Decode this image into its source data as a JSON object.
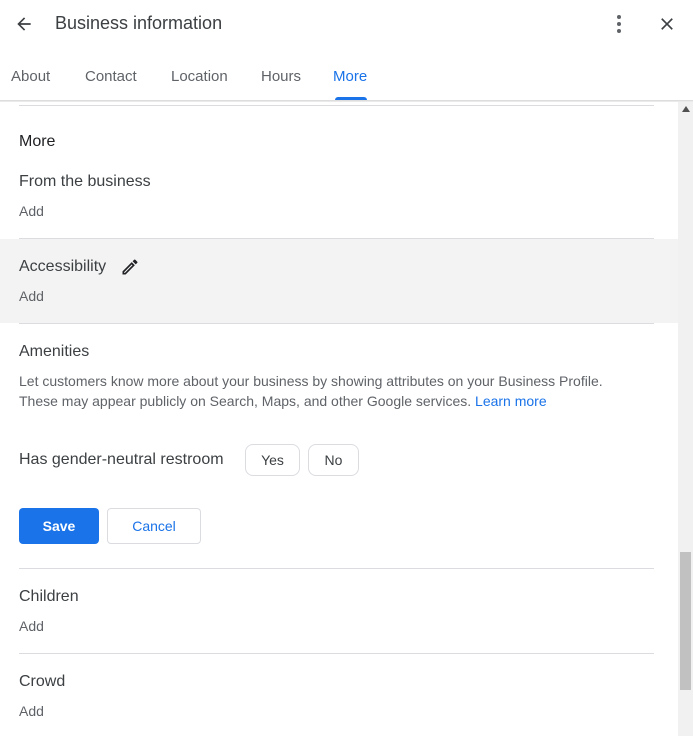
{
  "header": {
    "title": "Business information",
    "back_icon": "arrow-back-icon",
    "more_icon": "more-vert-icon",
    "close_icon": "close-icon"
  },
  "tabs": [
    {
      "label": "About",
      "active": false
    },
    {
      "label": "Contact",
      "active": false
    },
    {
      "label": "Location",
      "active": false
    },
    {
      "label": "Hours",
      "active": false
    },
    {
      "label": "More",
      "active": true
    }
  ],
  "section": {
    "heading": "More",
    "from_business": {
      "title": "From the business",
      "add": "Add"
    },
    "accessibility": {
      "title": "Accessibility",
      "add": "Add",
      "edit_icon": "pencil-icon"
    },
    "amenities": {
      "title": "Amenities",
      "description": "Let customers know more about your business by showing attributes on your Business Profile. These may appear publicly on Search, Maps, and other Google services.",
      "learn_more": "Learn more",
      "attribute_label": "Has gender-neutral restroom",
      "yes": "Yes",
      "no": "No",
      "save": "Save",
      "cancel": "Cancel"
    },
    "children": {
      "title": "Children",
      "add": "Add"
    },
    "crowd": {
      "title": "Crowd",
      "add": "Add"
    }
  },
  "colors": {
    "accent": "#1a73e8",
    "text": "#202124",
    "secondary_text": "#5f6368",
    "divider": "#dadce0",
    "highlight": "#f3f3f3"
  }
}
